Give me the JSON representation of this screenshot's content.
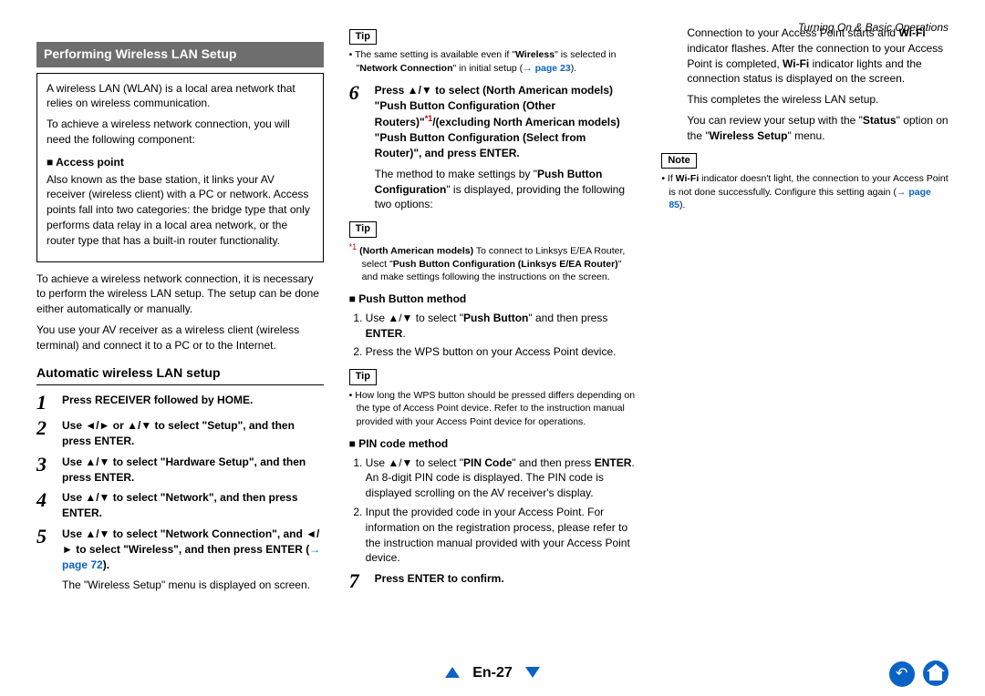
{
  "breadcrumb": "Turning On & Basic Operations",
  "section_title": "Performing Wireless LAN Setup",
  "box": {
    "intro1": "A wireless LAN (WLAN) is a local area network that relies on wireless communication.",
    "intro2": "To achieve a wireless network connection, you will need the following component:",
    "ap_heading": "Access point",
    "ap_body": "Also known as the base station, it links your AV receiver (wireless client) with a PC or network. Access points fall into two categories: the bridge type that only performs data relay in a local area network, or the router type that has a built-in router functionality."
  },
  "para1": "To achieve a wireless network connection, it is necessary to perform the wireless LAN setup. The setup can be done either automatically or manually.",
  "para2": "You use your AV receiver as a wireless client (wireless terminal) and connect it to a PC or to the Internet.",
  "subsection": "Automatic wireless LAN setup",
  "steps": {
    "1": "Press RECEIVER followed by HOME.",
    "2": "Use ◄/► or ▲/▼ to select \"Setup\", and then press ENTER.",
    "3": "Use ▲/▼ to select \"Hardware Setup\", and then press ENTER.",
    "4": "Use ▲/▼ to select \"Network\", and then press ENTER.",
    "5_pre": "Use ▲/▼ to select \"Network Connection\", and ◄/► to select \"Wireless\", and then press ENTER (",
    "5_link": "page 72",
    "5_post": ").",
    "5_extra": "The \"Wireless Setup\" menu is displayed on screen.",
    "6_main": "Press ▲/▼ to select (North American models) \"Push Button Configuration (Other Routers)\"*1/(excluding North American models) \"Push Button Configuration (Select from Router)\", and press ENTER.",
    "6_extra": "The method to make settings by \"Push Button Configuration\" is displayed, providing the following two options:",
    "7": "Press ENTER to confirm.",
    "7_extra1_pre": "Connection to your Access Point starts and ",
    "7_extra1_mid": " indicator flashes. After the connection to your Access Point is completed, ",
    "7_extra1_post": " indicator lights and the connection status is displayed on the screen.",
    "7_extra2": "This completes the wireless LAN setup.",
    "7_extra3_pre": "You can review your setup with the \"",
    "7_extra3_mid": "\" option on the \"",
    "7_extra3_post": "\" menu."
  },
  "tip5": {
    "label": "Tip",
    "text_pre": "The same setting is available even if \"",
    "text_bold": "Wireless",
    "text_mid": "\" is selected in \"",
    "text_bold2": "Network Connection",
    "text_post": "\" in initial setup (",
    "link": "page 23",
    "text_end": ")."
  },
  "tip6": {
    "label": "Tip",
    "star": "*1",
    "text_pre": "(North American models)",
    "text_body": " To connect to Linksys E/EA Router, select \"",
    "text_bold": "Push Button Configuration (Linksys E/EA Router)",
    "text_post": "\" and make settings following the instructions on the screen."
  },
  "push_button": {
    "heading": "Push Button method",
    "li1_pre": "Use ▲/▼ to select \"",
    "li1_bold": "Push Button",
    "li1_mid": "\" and then press ",
    "li1_bold2": "ENTER",
    "li1_post": ".",
    "li2": "Press the WPS button on your Access Point device."
  },
  "tip_pb": {
    "label": "Tip",
    "text": "How long the WPS button should be pressed differs depending on the type of Access Point device. Refer to the instruction manual provided with your Access Point device for operations."
  },
  "pin": {
    "heading": "PIN code method",
    "li1_pre": "Use ▲/▼ to select \"",
    "li1_bold": "PIN Code",
    "li1_mid": "\" and then press ",
    "li1_bold2": "ENTER",
    "li1_post": ".",
    "li1_extra": "An 8-digit PIN code is displayed. The PIN code is displayed scrolling on the AV receiver's display.",
    "li2": "Input the provided code in your Access Point. For information on the registration process, please refer to the instruction manual provided with your Access Point device."
  },
  "note7": {
    "label": "Note",
    "text_pre": "If ",
    "text_bold": "Wi-Fi",
    "text_mid": " indicator doesn't light, the connection to your Access Point is not done successfully. Configure this setting again (",
    "link": "page 85",
    "text_post": ")."
  },
  "wifi": "Wi-Fi",
  "status": "Status",
  "wireless_setup": "Wireless Setup",
  "page_number": "En-27"
}
